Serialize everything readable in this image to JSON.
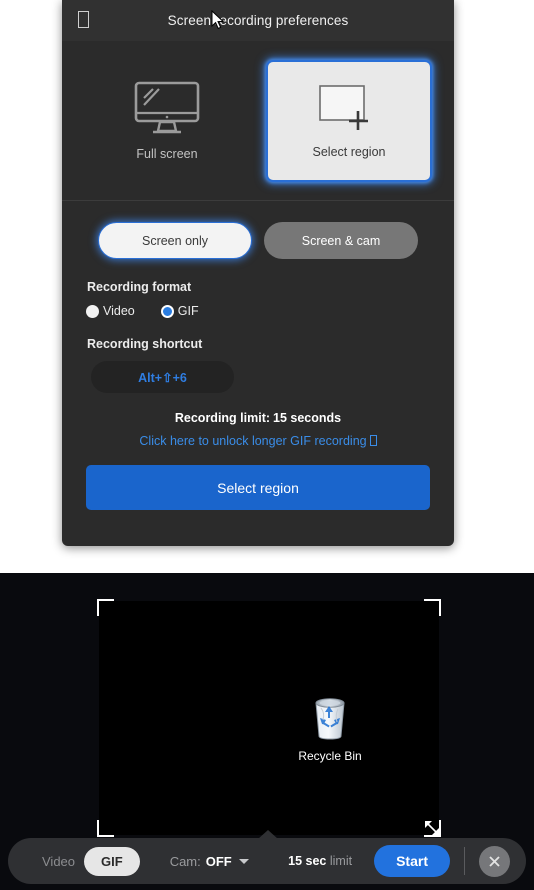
{
  "prefs": {
    "title": "Screen recording preferences",
    "titlebar_icon": "app-glyph-box",
    "modes": [
      {
        "label": "Full screen",
        "icon": "monitor-icon",
        "selected": false
      },
      {
        "label": "Select region",
        "icon": "region-select-icon",
        "selected": true
      }
    ],
    "sources": [
      {
        "label": "Screen only",
        "selected": true
      },
      {
        "label": "Screen & cam",
        "selected": false
      }
    ],
    "format": {
      "section_label": "Recording format",
      "options": [
        {
          "label": "Video",
          "selected": false
        },
        {
          "label": "GIF",
          "selected": true
        }
      ]
    },
    "shortcut": {
      "section_label": "Recording shortcut",
      "value": "Alt+⇧+6"
    },
    "limit": {
      "prefix": "Recording limit:",
      "value": "15 seconds"
    },
    "unlock_link": "Click here to unlock longer GIF recording",
    "primary_button": "Select region"
  },
  "overlay": {
    "desktop_icon": {
      "label": "Recycle Bin",
      "icon": "recycle-bin-icon"
    },
    "resize_handle_icon": "resize-diagonal-icon",
    "corner_handles": [
      "top-left",
      "top-right",
      "bottom-left",
      "bottom-right"
    ]
  },
  "toolbar": {
    "video_label": "Video",
    "gif_label": "GIF",
    "cam_prefix": "Cam:",
    "cam_value": "OFF",
    "limit_num": "15",
    "limit_unit": "sec",
    "limit_word": "limit",
    "start_label": "Start",
    "close_icon": "close-icon"
  },
  "colors": {
    "panel_bg": "#2b2b2b",
    "titlebar_bg": "#313131",
    "accent_blue": "#2a6fd6",
    "primary_button": "#1a65cc",
    "link_blue": "#3a8de8",
    "toolbar_bg": "#2f3033",
    "overlay_bg": "#090a0e"
  }
}
